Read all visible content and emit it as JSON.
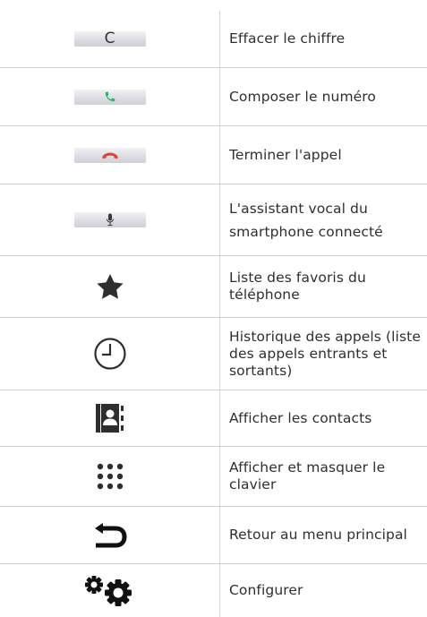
{
  "rows": [
    {
      "icon": "clear-digit-button-icon",
      "button_label": "C",
      "description": "Effacer le chiffre"
    },
    {
      "icon": "phone-call-icon",
      "description": "Composer le numéro",
      "color": "#2fb36b"
    },
    {
      "icon": "phone-hangup-icon",
      "description": "Terminer l'appel",
      "color": "#e0413a"
    },
    {
      "icon": "microphone-icon",
      "description": "L'assistant vocal du smartphone connecté"
    },
    {
      "icon": "star-icon",
      "description": "Liste des favoris du téléphone"
    },
    {
      "icon": "clock-icon",
      "description": "Historique des appels (liste des appels entrants et sortants)"
    },
    {
      "icon": "contacts-book-icon",
      "description": "Afficher les contacts"
    },
    {
      "icon": "keypad-icon",
      "description": "Afficher et masquer le clavier"
    },
    {
      "icon": "back-arrow-icon",
      "description": "Retour au menu principal"
    },
    {
      "icon": "gears-icon",
      "description": "Configurer"
    }
  ]
}
